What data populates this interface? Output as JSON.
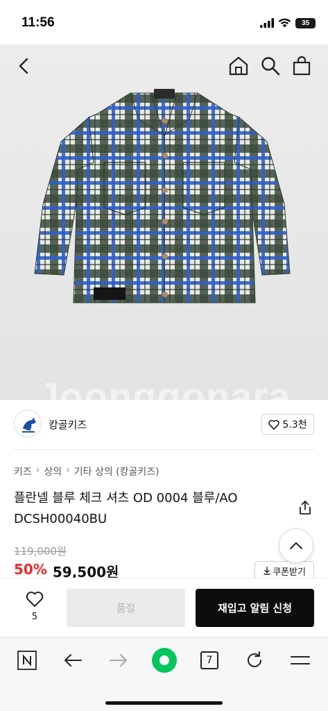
{
  "status_bar": {
    "time": "11:56",
    "battery": "35"
  },
  "hero": {
    "watermark": "Joonggonara"
  },
  "seller": {
    "name": "캉골키즈",
    "likes": "5.3천"
  },
  "breadcrumb": [
    "키즈",
    "상의",
    "기타 상의 (캉골키즈)"
  ],
  "product": {
    "title": "플란넬 블루 체크 셔츠 OD 0004 블루/AO DCSH00040BU",
    "original_price": "119,000원",
    "discount": "50%",
    "sale_price": "59,500원",
    "coupon_label": "쿠폰받기"
  },
  "action_bar": {
    "wish_count": "5",
    "soldout_label": "품절",
    "restock_label": "재입고 알림 신청"
  },
  "browser": {
    "tab_count": "7"
  },
  "colors": {
    "discount": "#ef2b2b",
    "primary_button": "#0d0d0d",
    "disabled_button": "#ebebeb",
    "naver_green": "#03c75a"
  }
}
